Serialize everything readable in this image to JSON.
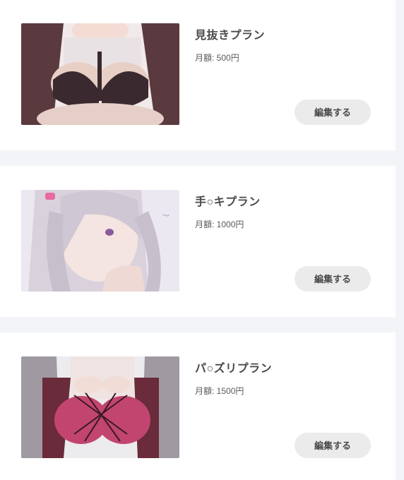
{
  "plans": [
    {
      "title": "見抜きプラン",
      "price": "月額: 500円",
      "button": "編集する",
      "image": "plan-thumbnail-illustration"
    },
    {
      "title": "手○キプラン",
      "price": "月額: 1000円",
      "button": "編集する",
      "image": "plan-thumbnail-illustration"
    },
    {
      "title": "パ○ズリプラン",
      "price": "月額: 1500円",
      "button": "編集する",
      "image": "plan-thumbnail-illustration"
    }
  ]
}
